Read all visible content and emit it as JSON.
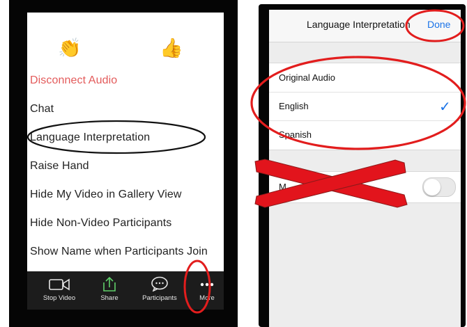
{
  "left_phone": {
    "reactions": {
      "clap_emoji": "👏",
      "thumbs_up_emoji": "👍"
    },
    "menu": [
      {
        "label": "Disconnect Audio",
        "color": "#e35b5b"
      },
      {
        "label": "Chat"
      },
      {
        "label": "Language Interpretation"
      },
      {
        "label": "Raise Hand"
      },
      {
        "label": "Hide My Video in Gallery View"
      },
      {
        "label": "Hide Non-Video Participants"
      },
      {
        "label": "Show Name when Participants Join"
      }
    ],
    "toolbar": {
      "stop_video": "Stop Video",
      "share": "Share",
      "participants": "Participants",
      "more": "More"
    }
  },
  "right_phone": {
    "title": "Language Interpretation",
    "done": "Done",
    "options": [
      {
        "label": "Original Audio"
      },
      {
        "label": "English",
        "selected": true
      },
      {
        "label": "Spanish"
      }
    ],
    "mute_row_label": "M",
    "mute_toggle_on": false
  },
  "annotation_colors": {
    "circle_red": "#e21d1d",
    "ellipse_black": "#111111",
    "cross_red": "#e2141c"
  }
}
